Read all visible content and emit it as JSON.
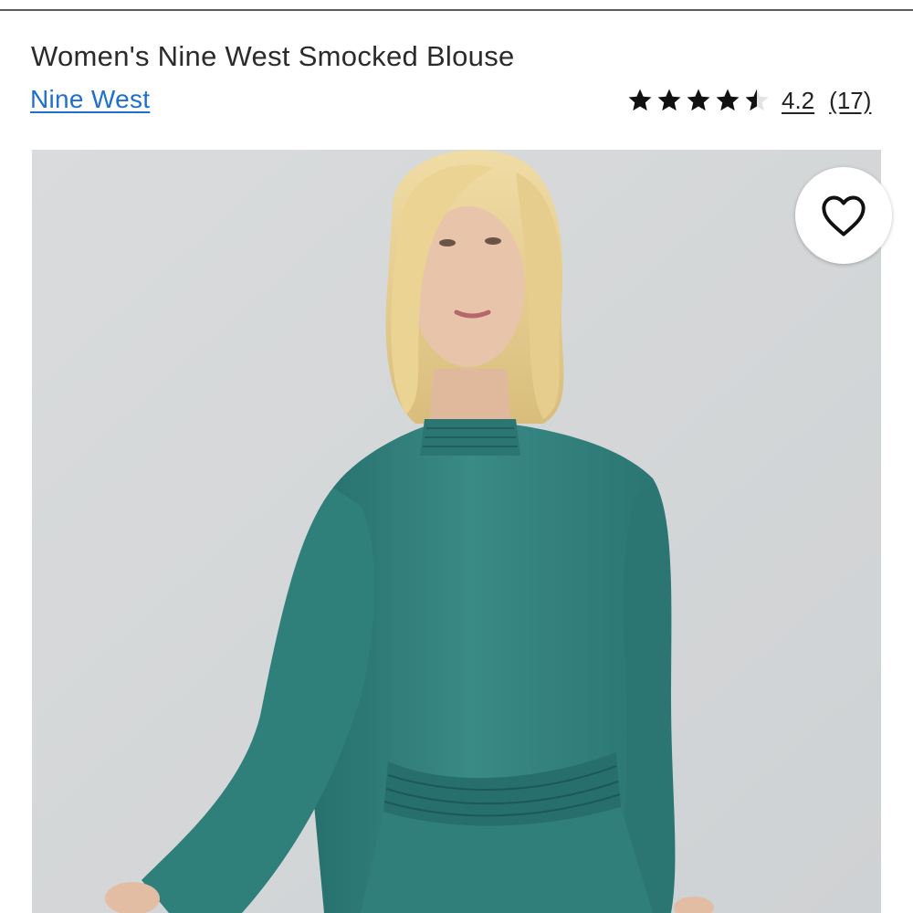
{
  "product": {
    "title": "Women's Nine West Smocked Blouse",
    "brand": "Nine West",
    "rating_value": "4.2",
    "review_count": "(17)",
    "stars": {
      "filled": 4,
      "partial": 0.5,
      "total": 5
    }
  },
  "image": {
    "alt_subject": "model-wearing-teal-smocked-blouse",
    "colors": {
      "background": "#d7d9db",
      "blouse": "#2f7d7a",
      "hair": "#e6cf92",
      "skin": "#e7c3a8"
    }
  },
  "favorite": {
    "icon": "heart-outline-icon"
  },
  "colors": {
    "link": "#1f6fd1",
    "text": "#222222",
    "rule": "#5a5a5a"
  }
}
